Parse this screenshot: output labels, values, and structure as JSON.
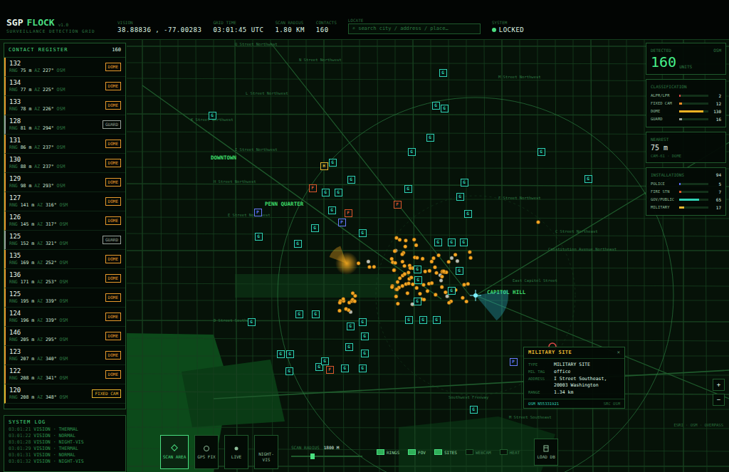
{
  "header": {
    "logo": "SGP",
    "title": "FLOCK",
    "version": "v1.0",
    "subtitle": "SURVEILLANCE DETECTION GRID",
    "fields": [
      {
        "label": "VISION",
        "value": "38.88836 , -77.00283"
      },
      {
        "label": "GRID TIME",
        "value": "03:01:45 UTC"
      },
      {
        "label": "SCAN RADIUS",
        "value": "1.80 KM"
      },
      {
        "label": "CONTACTS",
        "value": "160"
      }
    ],
    "locate": {
      "label": "LOCATE",
      "placeholder": "⌕ search city / address / place…"
    },
    "system": {
      "label": "SYSTEM",
      "value": "LOCKED",
      "on": true
    }
  },
  "register": {
    "title": "CONTACT REGISTER",
    "count": "160",
    "rangeLabel": "RNG",
    "azLabel": "AZ",
    "rows": [
      {
        "id": "132",
        "rng": "75 m",
        "az": "227°",
        "src": "OSM",
        "tag": "DOME",
        "color": "#e89a2c"
      },
      {
        "id": "134",
        "rng": "77 m",
        "az": "225°",
        "src": "OSM",
        "tag": "DOME",
        "color": "#e89a2c"
      },
      {
        "id": "133",
        "rng": "78 m",
        "az": "226°",
        "src": "OSM",
        "tag": "DOME",
        "color": "#e89a2c"
      },
      {
        "id": "128",
        "rng": "81 m",
        "az": "294°",
        "src": "OSM",
        "tag": "GUARD",
        "color": "#9aa39c"
      },
      {
        "id": "131",
        "rng": "86 m",
        "az": "237°",
        "src": "OSM",
        "tag": "DOME",
        "color": "#e89a2c"
      },
      {
        "id": "130",
        "rng": "88 m",
        "az": "237°",
        "src": "OSM",
        "tag": "DOME",
        "color": "#e89a2c"
      },
      {
        "id": "129",
        "rng": "98 m",
        "az": "293°",
        "src": "OSM",
        "tag": "DOME",
        "color": "#e89a2c"
      },
      {
        "id": "127",
        "rng": "141 m",
        "az": "316°",
        "src": "OSM",
        "tag": "DOME",
        "color": "#e89a2c"
      },
      {
        "id": "126",
        "rng": "145 m",
        "az": "317°",
        "src": "OSM",
        "tag": "DOME",
        "color": "#e89a2c"
      },
      {
        "id": "125",
        "rng": "152 m",
        "az": "321°",
        "src": "OSM",
        "tag": "GUARD",
        "color": "#9aa39c"
      },
      {
        "id": "135",
        "rng": "169 m",
        "az": "252°",
        "src": "OSM",
        "tag": "DOME",
        "color": "#e89a2c"
      },
      {
        "id": "136",
        "rng": "171 m",
        "az": "253°",
        "src": "OSM",
        "tag": "DOME",
        "color": "#e89a2c"
      },
      {
        "id": "125",
        "rng": "195 m",
        "az": "339°",
        "src": "OSM",
        "tag": "DOME",
        "color": "#e89a2c"
      },
      {
        "id": "124",
        "rng": "196 m",
        "az": "339°",
        "src": "OSM",
        "tag": "DOME",
        "color": "#e89a2c"
      },
      {
        "id": "146",
        "rng": "205 m",
        "az": "295°",
        "src": "OSM",
        "tag": "DOME",
        "color": "#e89a2c"
      },
      {
        "id": "123",
        "rng": "207 m",
        "az": "340°",
        "src": "OSM",
        "tag": "DOME",
        "color": "#e89a2c"
      },
      {
        "id": "122",
        "rng": "208 m",
        "az": "341°",
        "src": "OSM",
        "tag": "DOME",
        "color": "#e89a2c"
      },
      {
        "id": "120",
        "rng": "208 m",
        "az": "348°",
        "src": "OSM",
        "tag": "FIXED CAM",
        "color": "#e8b22c"
      }
    ]
  },
  "log": {
    "title": "SYSTEM LOG",
    "entries": [
      {
        "time": "03:01:21",
        "text": "VISION · THERMAL"
      },
      {
        "time": "03:01:22",
        "text": "VISION · NORMAL"
      },
      {
        "time": "03:01:28",
        "text": "VISION · NIGHT-VIS"
      },
      {
        "time": "03:01:29",
        "text": "VISION · THERMAL"
      },
      {
        "time": "03:01:31",
        "text": "VISION · NORMAL"
      },
      {
        "time": "03:01:32",
        "text": "VISION · NIGHT-VIS"
      }
    ]
  },
  "stats": {
    "detected": {
      "label": "DETECTED",
      "source": "OSM",
      "value": "160",
      "unit": "UNITS"
    },
    "classification": {
      "title": "CLASSIFICATION",
      "items": [
        {
          "name": "ALPR/LPR",
          "count": "2",
          "level": 0.04,
          "color": "#e04848"
        },
        {
          "name": "FIXED CAM",
          "count": "12",
          "level": 0.09,
          "color": "#f08a24"
        },
        {
          "name": "DOME",
          "count": "130",
          "level": 0.82,
          "color": "#f5b323"
        },
        {
          "name": "GUARD",
          "count": "16",
          "level": 0.1,
          "color": "#9aa39c"
        }
      ]
    },
    "nearest": {
      "title": "NEAREST",
      "value": "75 m",
      "detail": "CAM-61 · DOME"
    },
    "installations": {
      "title": "INSTALLATIONS",
      "count": "94",
      "items": [
        {
          "name": "POLICE",
          "count": "5",
          "level": 0.05,
          "color": "#5b6cff"
        },
        {
          "name": "FIRE STN",
          "count": "7",
          "level": 0.07,
          "color": "#e0572b"
        },
        {
          "name": "GOV/PUBLIC",
          "count": "65",
          "level": 0.69,
          "color": "#2fd3b5"
        },
        {
          "name": "MILITARY",
          "count": "17",
          "level": 0.18,
          "color": "#e8b931"
        }
      ]
    }
  },
  "map": {
    "areas": [
      {
        "label": "DOWNTOWN"
      },
      {
        "label": "PENN QUARTER"
      },
      {
        "label": "CAPITOL HILL"
      }
    ],
    "streets": [
      {
        "label": "O Street Northwest"
      },
      {
        "label": "N Street Northwest"
      },
      {
        "label": "M Street Northwest"
      },
      {
        "label": "L Street Northwest"
      },
      {
        "label": "K Street Northwest"
      },
      {
        "label": "I Street Northwest"
      },
      {
        "label": "H Street Northwest"
      },
      {
        "label": "F Street Northwest"
      },
      {
        "label": "E Street Northwest"
      },
      {
        "label": "C Street Northeast"
      },
      {
        "label": "Constitution Avenue Northeast"
      },
      {
        "label": "East Capitol Street"
      },
      {
        "label": "D Street Southwest"
      },
      {
        "label": "Southwest Freeway"
      },
      {
        "label": "M Street Southeast"
      }
    ],
    "sites": [
      {
        "label": "G",
        "color": "#2fd3b5"
      },
      {
        "label": "G",
        "color": "#2fd3b5"
      },
      {
        "label": "G",
        "color": "#2fd3b5"
      },
      {
        "label": "G",
        "color": "#2fd3b5"
      },
      {
        "label": "G",
        "color": "#2fd3b5"
      },
      {
        "label": "G",
        "color": "#2fd3b5"
      },
      {
        "label": "G",
        "color": "#2fd3b5"
      },
      {
        "label": "G",
        "color": "#2fd3b5"
      },
      {
        "label": "G",
        "color": "#2fd3b5"
      },
      {
        "label": "G",
        "color": "#2fd3b5"
      },
      {
        "label": "G",
        "color": "#2fd3b5"
      },
      {
        "label": "G",
        "color": "#2fd3b5"
      },
      {
        "label": "G",
        "color": "#2fd3b5"
      },
      {
        "label": "G",
        "color": "#2fd3b5"
      },
      {
        "label": "G",
        "color": "#2fd3b5"
      },
      {
        "label": "G",
        "color": "#2fd3b5"
      },
      {
        "label": "G",
        "color": "#2fd3b5"
      },
      {
        "label": "G",
        "color": "#2fd3b5"
      },
      {
        "label": "G",
        "color": "#2fd3b5"
      },
      {
        "label": "G",
        "color": "#2fd3b5"
      },
      {
        "label": "G",
        "color": "#2fd3b5"
      },
      {
        "label": "G",
        "color": "#2fd3b5"
      },
      {
        "label": "G",
        "color": "#2fd3b5"
      },
      {
        "label": "G",
        "color": "#2fd3b5"
      },
      {
        "label": "G",
        "color": "#2fd3b5"
      },
      {
        "label": "G",
        "color": "#2fd3b5"
      },
      {
        "label": "G",
        "color": "#2fd3b5"
      },
      {
        "label": "G",
        "color": "#2fd3b5"
      },
      {
        "label": "G",
        "color": "#2fd3b5"
      },
      {
        "label": "G",
        "color": "#2fd3b5"
      },
      {
        "label": "G",
        "color": "#2fd3b5"
      },
      {
        "label": "G",
        "color": "#2fd3b5"
      },
      {
        "label": "G",
        "color": "#2fd3b5"
      },
      {
        "label": "G",
        "color": "#2fd3b5"
      },
      {
        "label": "G",
        "color": "#2fd3b5"
      },
      {
        "label": "G",
        "color": "#2fd3b5"
      },
      {
        "label": "G",
        "color": "#2fd3b5"
      },
      {
        "label": "G",
        "color": "#2fd3b5"
      },
      {
        "label": "G",
        "color": "#2fd3b5"
      },
      {
        "label": "G",
        "color": "#2fd3b5"
      },
      {
        "label": "G",
        "color": "#2fd3b5"
      },
      {
        "label": "G",
        "color": "#2fd3b5"
      },
      {
        "label": "G",
        "color": "#2fd3b5"
      },
      {
        "label": "G",
        "color": "#2fd3b5"
      },
      {
        "label": "G",
        "color": "#2fd3b5"
      },
      {
        "label": "G",
        "color": "#2fd3b5"
      },
      {
        "label": "G",
        "color": "#2fd3b5"
      },
      {
        "label": "G",
        "color": "#2fd3b5"
      },
      {
        "label": "F",
        "color": "#e0572b"
      },
      {
        "label": "F",
        "color": "#e0572b"
      },
      {
        "label": "F",
        "color": "#e0572b"
      },
      {
        "label": "F",
        "color": "#e0572b"
      },
      {
        "label": "P",
        "color": "#6b7bff"
      },
      {
        "label": "P",
        "color": "#6b7bff"
      },
      {
        "label": "P",
        "color": "#6b7bff"
      },
      {
        "label": "H",
        "color": "#e8b931"
      }
    ]
  },
  "popup": {
    "title": "MILITARY SITE",
    "close": "✕",
    "rows": [
      {
        "label": "TYPE",
        "value": "MILITARY SITE"
      },
      {
        "label": "MIL TAG",
        "value": "office"
      },
      {
        "label": "ADDRESS",
        "value": "I Street Southeast, 20003 Washington"
      },
      {
        "label": "RANGE",
        "value": "1.34 km"
      }
    ],
    "footer": {
      "id": "OSM N55331921",
      "source": "SRC OSM"
    }
  },
  "controls": {
    "buttons": [
      {
        "label": "SCAN AREA",
        "selected": true
      },
      {
        "label": "GPS FIX",
        "selected": false
      },
      {
        "label": "LIVE",
        "selected": false
      },
      {
        "label": "NIGHT-VIS",
        "selected": false
      }
    ],
    "slider": {
      "label": "SCAN RADIUS",
      "reading": "1800 M",
      "level": 0.3
    },
    "toggles": [
      {
        "label": "RINGS",
        "on": true
      },
      {
        "label": "FOV",
        "on": true
      },
      {
        "label": "SITES",
        "on": true
      },
      {
        "label": "WEBCAM",
        "on": false
      },
      {
        "label": "HEAT",
        "on": false
      }
    ],
    "load": {
      "label": "LOAD DB"
    }
  },
  "zoom": [
    "+",
    "−"
  ],
  "attribution": "ESRI · OSM · OVERPASS"
}
